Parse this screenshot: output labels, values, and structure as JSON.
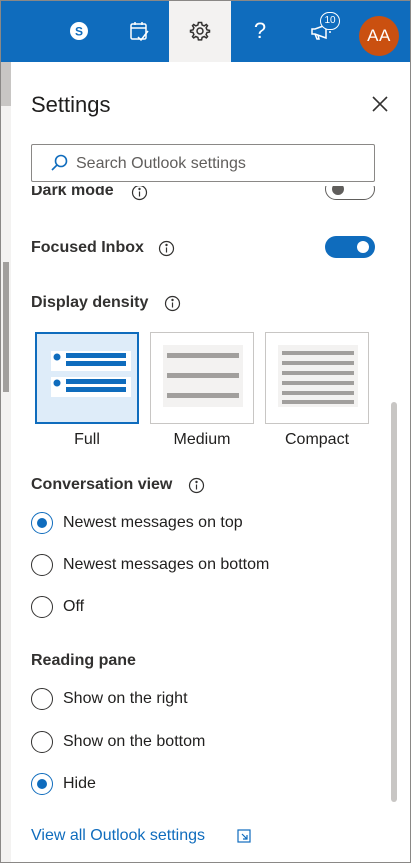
{
  "topbar": {
    "skype_icon": "skype-icon",
    "calendar_icon": "calendar-check-icon",
    "settings_icon": "gear-icon",
    "help_label": "?",
    "whats_new_icon": "megaphone-icon",
    "notification_count": "10",
    "avatar_initials": "AA",
    "accent_color": "#0f6cbd"
  },
  "settings": {
    "title": "Settings",
    "search_placeholder": "Search Outlook settings",
    "dark_mode_label": "Dark mode",
    "dark_mode_on": false,
    "focused_inbox_label": "Focused Inbox",
    "focused_inbox_on": true,
    "display_density": {
      "label": "Display density",
      "options": [
        "Full",
        "Medium",
        "Compact"
      ],
      "selected": "Full"
    },
    "conversation_view": {
      "label": "Conversation view",
      "options": [
        "Newest messages on top",
        "Newest messages on bottom",
        "Off"
      ],
      "selected": "Newest messages on top"
    },
    "reading_pane": {
      "label": "Reading pane",
      "options": [
        "Show on the right",
        "Show on the bottom",
        "Hide"
      ],
      "selected": "Hide"
    },
    "view_all_link": "View all Outlook settings"
  }
}
